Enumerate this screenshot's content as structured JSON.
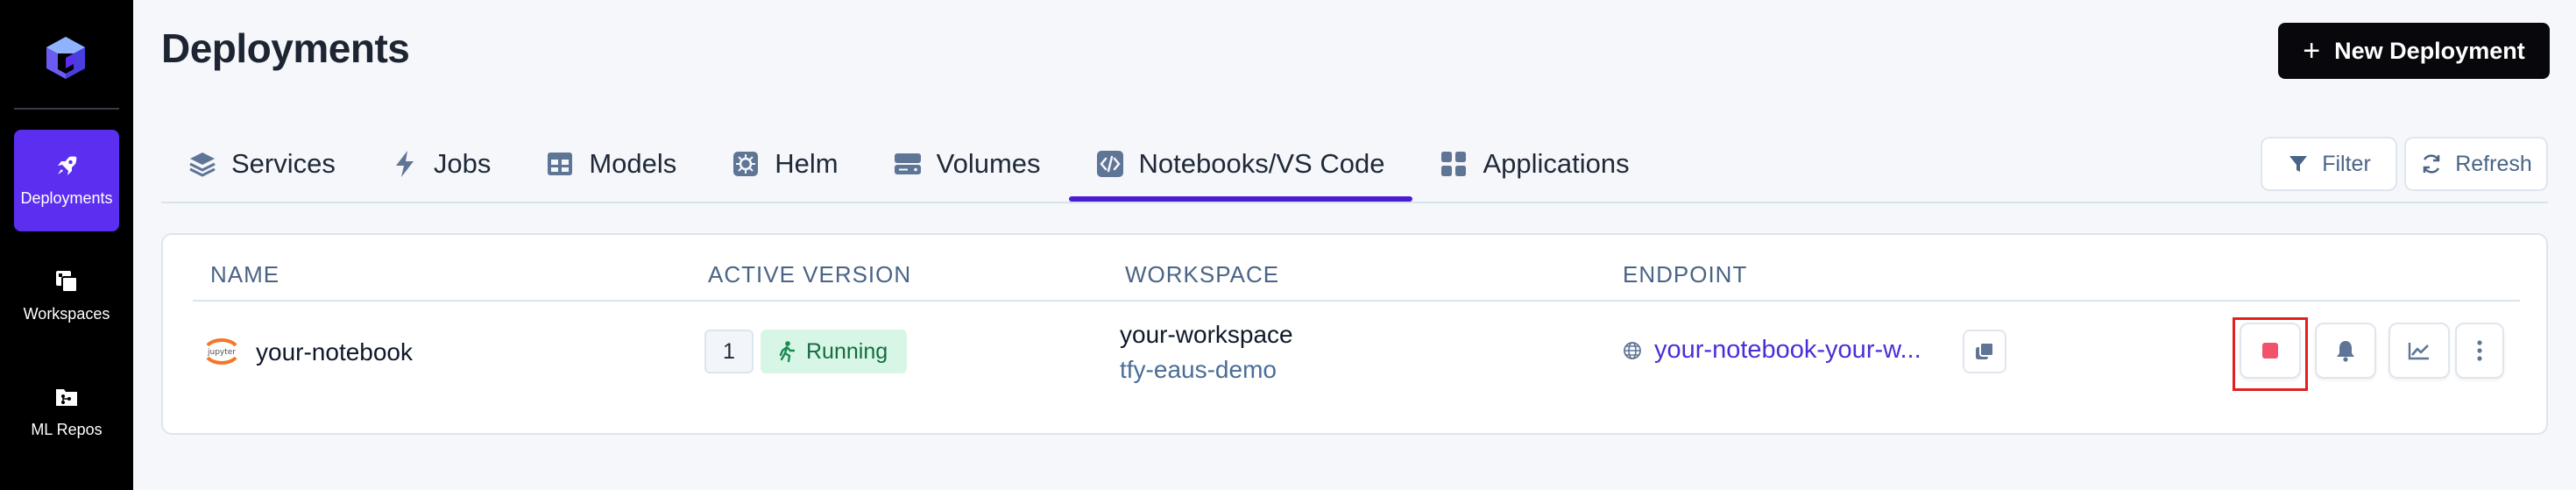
{
  "sidebar": {
    "logo": "truefoundry-logo-icon",
    "items": [
      {
        "label": "Deployments",
        "icon": "rocket-icon",
        "active": true
      },
      {
        "label": "Workspaces",
        "icon": "workspaces-icon",
        "active": false
      },
      {
        "label": "ML Repos",
        "icon": "folder-git-icon",
        "active": false
      }
    ]
  },
  "header": {
    "title": "Deployments",
    "new_button": {
      "plus": "+",
      "label": "New Deployment"
    }
  },
  "tabs": [
    {
      "label": "Services",
      "icon": "layers-icon"
    },
    {
      "label": "Jobs",
      "icon": "lightning-icon"
    },
    {
      "label": "Models",
      "icon": "table-icon"
    },
    {
      "label": "Helm",
      "icon": "helm-icon"
    },
    {
      "label": "Volumes",
      "icon": "hard-drive-icon"
    },
    {
      "label": "Notebooks/VS Code",
      "icon": "code-icon",
      "active": true
    },
    {
      "label": "Applications",
      "icon": "grid-icon"
    }
  ],
  "toolbar": {
    "filter_label": "Filter",
    "refresh_label": "Refresh"
  },
  "table": {
    "columns": [
      "NAME",
      "ACTIVE VERSION",
      "WORKSPACE",
      "ENDPOINT"
    ],
    "rows": [
      {
        "icon": "jupyter-icon",
        "icon_text": "jupyter",
        "name": "your-notebook",
        "version": "1",
        "status": "Running",
        "workspace": "your-workspace",
        "cluster": "tfy-eaus-demo",
        "endpoint": "your-notebook-your-w...",
        "actions": [
          "stop-icon",
          "bell-icon",
          "chart-icon",
          "more-vertical-icon"
        ]
      }
    ]
  },
  "colors": {
    "accent": "#5b2ef0",
    "highlight": "#e21f1f",
    "status_bg": "#d8f6e6",
    "status_fg": "#136c3f"
  }
}
